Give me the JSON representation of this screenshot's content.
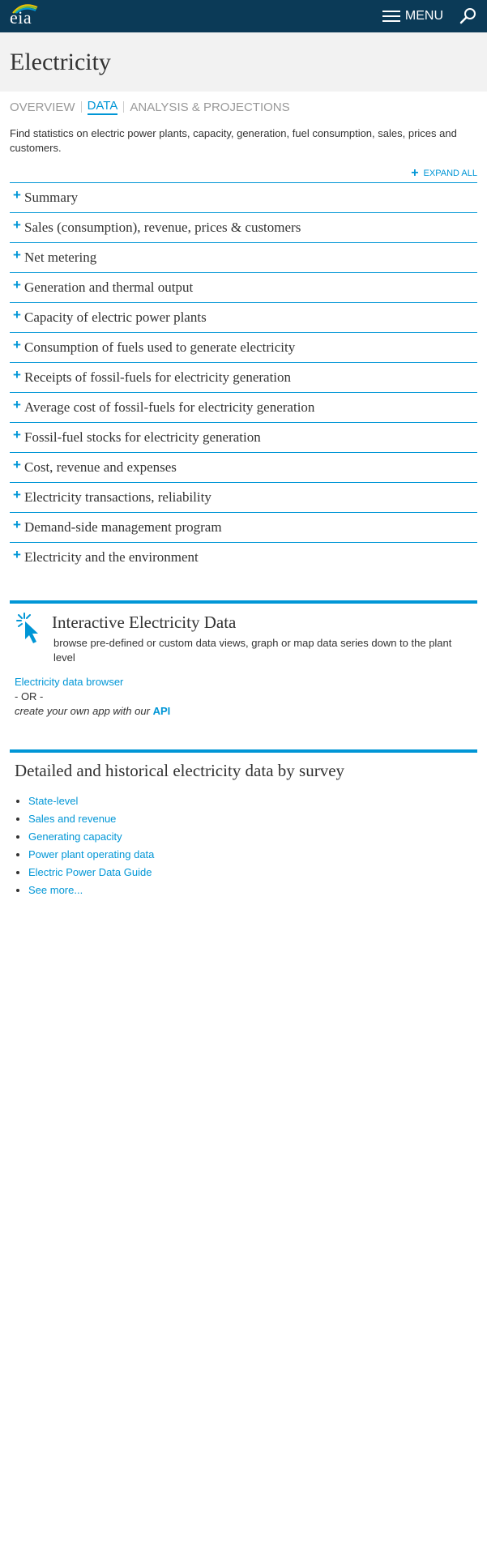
{
  "header": {
    "logo_text": "eia",
    "menu_label": "MENU",
    "background": "#0b3a57"
  },
  "page": {
    "title": "Electricity"
  },
  "subnav": {
    "tabs": [
      {
        "label": "OVERVIEW",
        "active": false
      },
      {
        "label": "DATA",
        "active": true
      },
      {
        "label": "ANALYSIS & PROJECTIONS",
        "active": false
      }
    ]
  },
  "intro": "Find statistics on electric power plants, capacity, generation, fuel consumption, sales, prices and customers.",
  "expand_all_label": "EXPAND ALL",
  "accordion": [
    {
      "label": "Summary"
    },
    {
      "label": "Sales (consumption), revenue, prices & customers"
    },
    {
      "label": "Net metering"
    },
    {
      "label": "Generation and thermal output"
    },
    {
      "label": "Capacity of electric power plants"
    },
    {
      "label": "Consumption of fuels used to generate electricity"
    },
    {
      "label": "Receipts of fossil-fuels for electricity generation"
    },
    {
      "label": "Average cost of fossil-fuels for electricity generation"
    },
    {
      "label": "Fossil-fuel stocks for electricity generation"
    },
    {
      "label": "Cost, revenue and expenses"
    },
    {
      "label": "Electricity transactions, reliability"
    },
    {
      "label": "Demand-side management program"
    },
    {
      "label": "Electricity and the environment"
    }
  ],
  "interactive": {
    "title": "Interactive Electricity Data",
    "description": "browse pre-defined or custom data views, graph or map data series down to the plant level",
    "browser_link": "Electricity data browser",
    "or_text": "- OR -",
    "api_text": "create your own app with our",
    "api_link": "API"
  },
  "survey": {
    "title": "Detailed and historical electricity data by survey",
    "links": [
      {
        "label": "State-level"
      },
      {
        "label": "Sales and revenue"
      },
      {
        "label": "Generating capacity"
      },
      {
        "label": "Power plant operating data"
      },
      {
        "label": "Electric Power Data Guide"
      },
      {
        "label": "See more..."
      }
    ]
  },
  "colors": {
    "accent": "#0096d6",
    "header_bg": "#0b3a57",
    "hero_bg": "#f2f2f2"
  }
}
